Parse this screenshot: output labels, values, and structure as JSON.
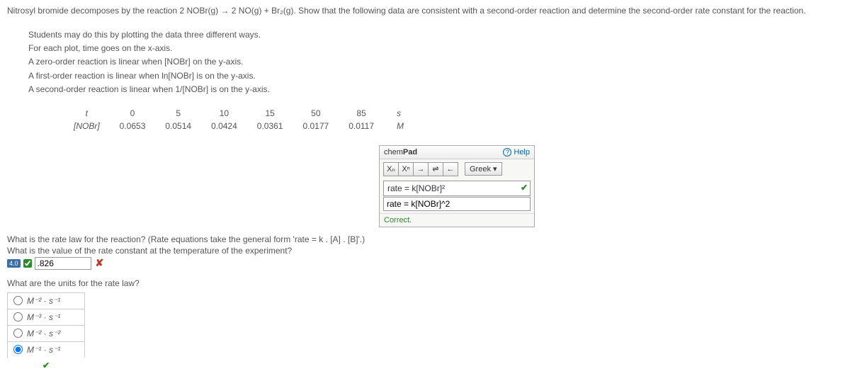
{
  "problem": "Nitrosyl bromide decomposes by the reaction 2 NOBr(g) → 2 NO(g) + Br₂(g). Show that the following data are consistent with a second-order reaction and determine the second-order rate constant for the reaction.",
  "hints": {
    "line1": "Students may do this by plotting the data three different ways.",
    "line2": "For each plot, time goes on the x-axis.",
    "line3": "A zero-order reaction is linear when [NOBr] on the y-axis.",
    "line4": "A first-order reaction is linear when ln[NOBr] is on the y-axis.",
    "line5": "A second-order reaction is linear when 1/[NOBr] is on the y-axis."
  },
  "table": {
    "row1_label": "t",
    "row2_label": "[NOBr]",
    "t": [
      "0",
      "5",
      "10",
      "15",
      "50",
      "85"
    ],
    "c": [
      "0.0653",
      "0.0514",
      "0.0424",
      "0.0361",
      "0.0177",
      "0.0117"
    ],
    "unit_t": "s",
    "unit_c": "M"
  },
  "chempad": {
    "title_plain": "chem",
    "title_bold": "Pad",
    "help": "Help",
    "greek": "Greek",
    "sub_btn": "Xₙ",
    "sup_btn": "Xⁿ",
    "arrow_fwd": "→",
    "arrow_eq": "⇌",
    "arrow_back": "←",
    "display": "rate = k[NOBr]²",
    "input_value": "rate = k[NOBr]^2",
    "status": "Correct."
  },
  "q_rate_law": "What is the rate law for the reaction? (Rate equations take the general form 'rate = k . [A] . [B]'.)",
  "q_rate_const": "What is the value of the rate constant at the temperature of the experiment?",
  "points_badge": "4.0",
  "rate_const_input": ".826",
  "q_units": "What are the units for the rate law?",
  "units_options": {
    "opt1": "M⁻² · s⁻¹",
    "opt2": "M⁻³ · s⁻¹",
    "opt3": "M⁻² · s⁻²",
    "opt4": "M⁻¹ · s⁻¹"
  }
}
